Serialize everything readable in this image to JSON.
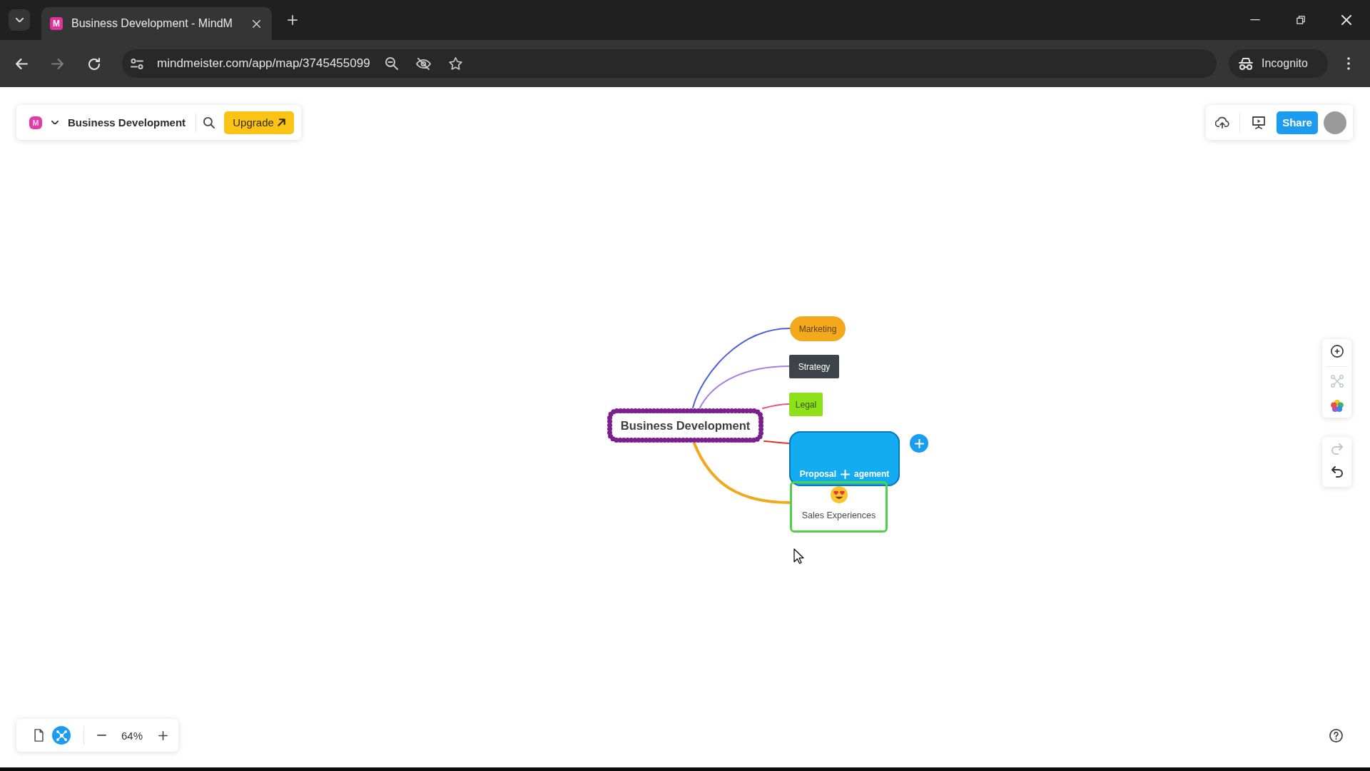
{
  "browser": {
    "tab": {
      "favicon_letter": "M",
      "title": "Business Development - MindM"
    },
    "url": "mindmeister.com/app/map/3745455099",
    "profile": "Incognito"
  },
  "toolbar": {
    "logo_letter": "M",
    "title": "Business Development",
    "upgrade": "Upgrade",
    "share": "Share"
  },
  "map": {
    "root": {
      "label": "Business Development",
      "color": "#7b1f8e",
      "selected": false
    },
    "topics": [
      {
        "kind": "pill",
        "label_parts": [
          "Marketing"
        ],
        "color": "#f4a91c",
        "branch": {
          "color": "#4a5fd8"
        },
        "selected": false
      },
      {
        "kind": "box",
        "label_parts": [
          "Strategy"
        ],
        "color": "#3e4249",
        "branch": {
          "color": "#a67ce6"
        },
        "selected": false
      },
      {
        "kind": "box",
        "label_parts": [
          "Legal"
        ],
        "color": "#8ee019",
        "branch": {
          "color": "#e8507a"
        },
        "selected": false
      },
      {
        "kind": "bubble",
        "label_parts": [
          "Proposal",
          "agement"
        ],
        "color": "#14acf0",
        "branch": {
          "color": "#d9342b"
        },
        "selected": true
      },
      {
        "kind": "card",
        "label_parts": [
          "Sales Experiences"
        ],
        "color": "#4fd14a",
        "branch": {
          "color": "#f2a81c"
        },
        "selected": false
      }
    ]
  },
  "side_tools": [
    {
      "tools": [
        {
          "kind": "focus",
          "disabled": false
        },
        {
          "kind": "layout",
          "disabled": true
        },
        {
          "kind": "colors",
          "disabled": false
        }
      ]
    },
    {
      "tools": [
        {
          "kind": "redo",
          "disabled": true
        },
        {
          "kind": "undo",
          "disabled": false
        }
      ]
    }
  ],
  "view_switch": [
    {
      "kind": "outline",
      "selected": false
    },
    {
      "kind": "mindmap",
      "selected": true
    }
  ],
  "zoom": "64%"
}
